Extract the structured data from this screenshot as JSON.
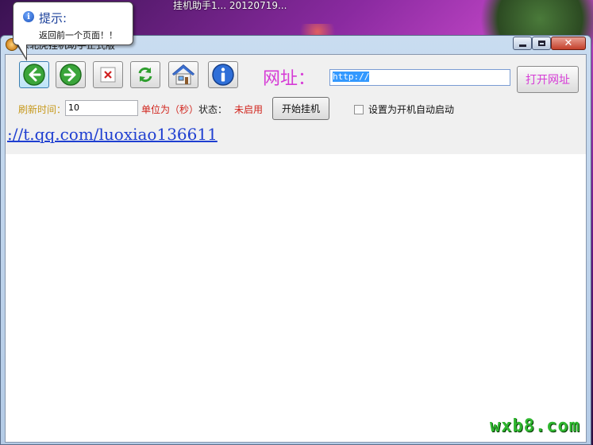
{
  "desktop": {
    "title": "挂机助手1...  20120719..."
  },
  "window": {
    "title": "东北虎挂机助手正式版",
    "controls": {
      "minimize": "",
      "maximize": "",
      "close": "✕"
    }
  },
  "toolbar": {
    "buttons": [
      {
        "name": "back",
        "icon": "back-arrow-icon"
      },
      {
        "name": "forward",
        "icon": "forward-arrow-icon"
      },
      {
        "name": "stop",
        "icon": "stop-x-icon"
      },
      {
        "name": "refresh",
        "icon": "refresh-icon"
      },
      {
        "name": "home",
        "icon": "home-icon"
      },
      {
        "name": "about",
        "icon": "info-icon"
      }
    ],
    "url_label": "网址：",
    "url_value": "http://",
    "open_button": "打开网址"
  },
  "settings": {
    "refresh_label": "刷新时间：",
    "refresh_value": "10",
    "unit_label": "单位为（秒）",
    "status_label": "状态：",
    "status_value": "未启用",
    "start_button": "开始挂机",
    "autostart_label": "设置为开机自动启动",
    "autostart_checked": false
  },
  "link": {
    "text": "://t.qq.com/luoxiao136611"
  },
  "tooltip": {
    "title": "提示:",
    "text": "返回前一个页面！！"
  },
  "watermark": "wxb8.com",
  "colors": {
    "label_magenta": "#d63bd6",
    "status_red": "#d1241c",
    "refresh_gold": "#c79a1e",
    "link_blue": "#1f3fd1",
    "watermark_green": "#2fb62f"
  }
}
